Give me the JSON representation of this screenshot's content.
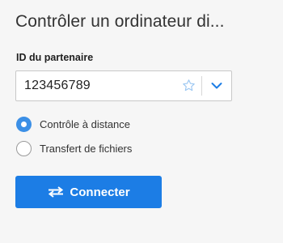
{
  "panel": {
    "title": "Contrôler un ordinateur di...",
    "partner_id_label": "ID du partenaire",
    "partner_id_value": "123456789",
    "star_icon": "star-icon",
    "dropdown_icon": "chevron-down-icon"
  },
  "mode": {
    "options": [
      {
        "label": "Contrôle à distance",
        "selected": true
      },
      {
        "label": "Transfert de fichiers",
        "selected": false
      }
    ]
  },
  "connect": {
    "label": "Connecter",
    "icon": "swap-arrows-icon"
  },
  "colors": {
    "accent": "#1c7de5",
    "radio_selected": "#3b8fe6",
    "background": "#f6f6f6"
  }
}
